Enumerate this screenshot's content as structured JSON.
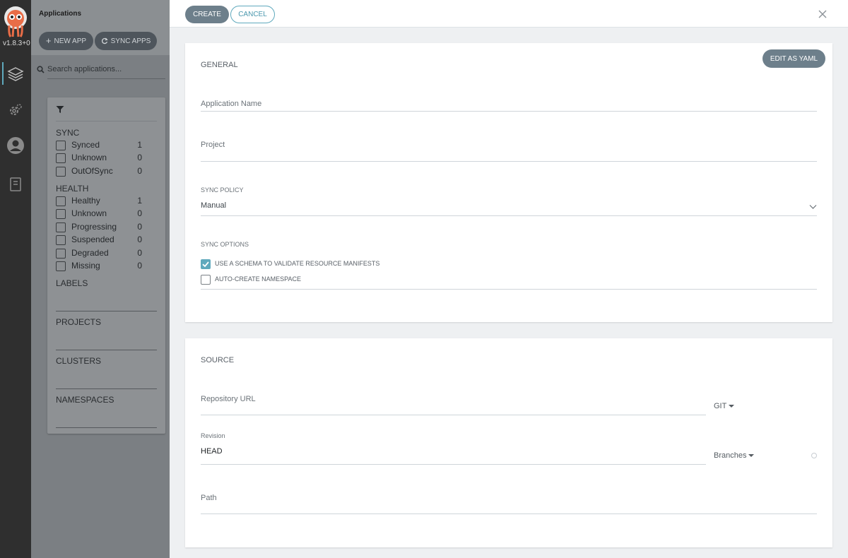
{
  "nav": {
    "version": "v1.8.3+0"
  },
  "apps_panel": {
    "title": "Applications",
    "new_app": "NEW APP",
    "sync_apps": "SYNC APPS",
    "search_placeholder": "Search applications...",
    "filters": {
      "sync_heading": "SYNC",
      "sync": [
        {
          "label": "Synced",
          "count": "1"
        },
        {
          "label": "Unknown",
          "count": "0"
        },
        {
          "label": "OutOfSync",
          "count": "0"
        }
      ],
      "health_heading": "HEALTH",
      "health": [
        {
          "label": "Healthy",
          "count": "1"
        },
        {
          "label": "Unknown",
          "count": "0"
        },
        {
          "label": "Progressing",
          "count": "0"
        },
        {
          "label": "Suspended",
          "count": "0"
        },
        {
          "label": "Degraded",
          "count": "0"
        },
        {
          "label": "Missing",
          "count": "0"
        }
      ],
      "labels": "LABELS",
      "projects": "PROJECTS",
      "clusters": "CLUSTERS",
      "namespaces": "NAMESPACES"
    }
  },
  "dialog": {
    "create": "CREATE",
    "cancel": "CANCEL",
    "general": {
      "heading": "GENERAL",
      "edit_yaml": "EDIT AS YAML",
      "app_name_label": "Application Name",
      "project_label": "Project",
      "sync_policy_label": "SYNC POLICY",
      "sync_policy_value": "Manual",
      "sync_options_label": "SYNC OPTIONS",
      "option_schema": "USE A SCHEMA TO VALIDATE RESOURCE MANIFESTS",
      "option_schema_checked": true,
      "option_namespace": "AUTO-CREATE NAMESPACE",
      "option_namespace_checked": false
    },
    "source": {
      "heading": "SOURCE",
      "repo_url_label": "Repository URL",
      "repo_type": "GIT",
      "revision_label": "Revision",
      "revision_value": "HEAD",
      "revision_type": "Branches",
      "path_label": "Path"
    }
  },
  "colors": {
    "accent": "#5fa9bd",
    "button": "#6d7f8b",
    "rail": "#2f2f2f"
  }
}
